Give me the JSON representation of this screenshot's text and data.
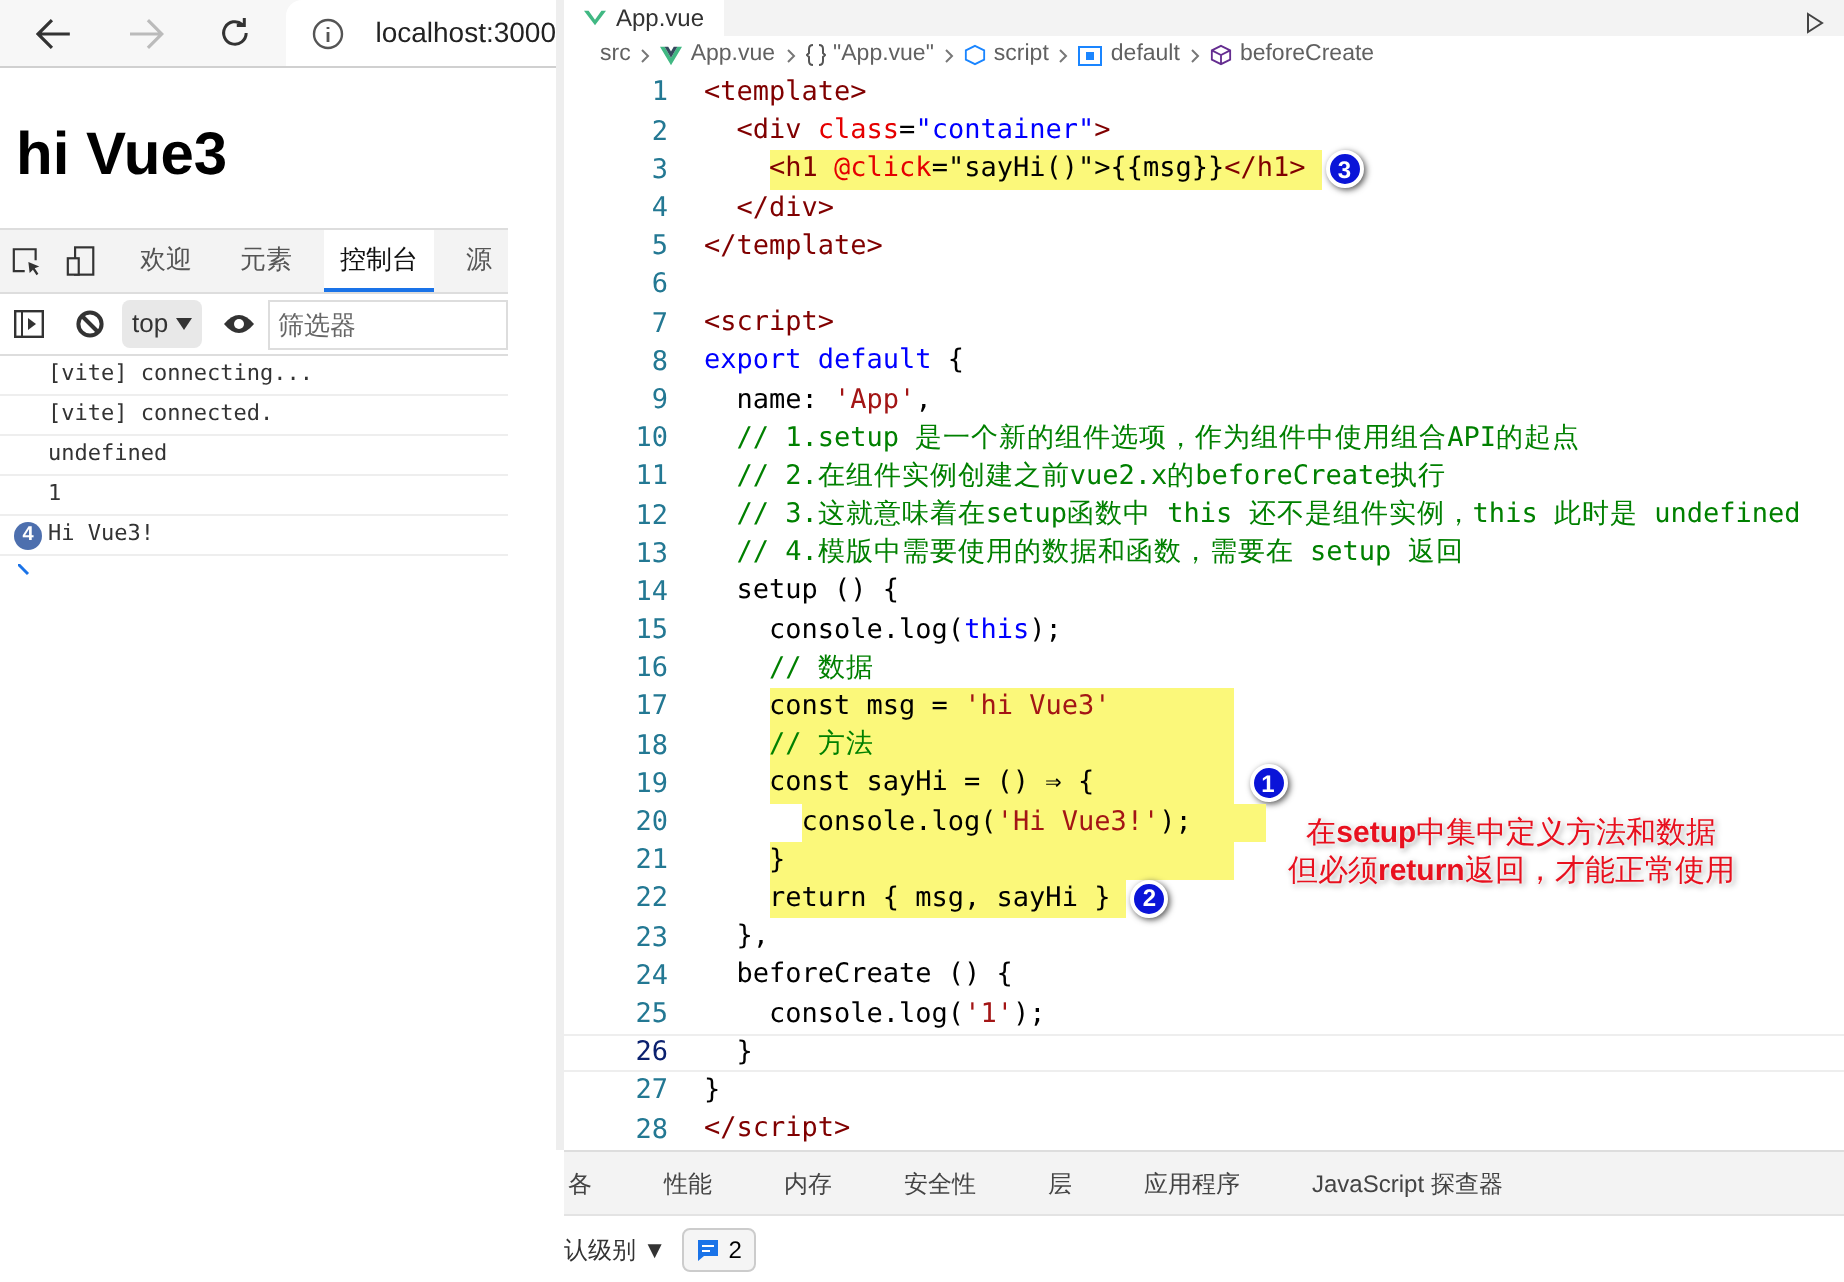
{
  "browser": {
    "url": "localhost:3000",
    "heading": "hi Vue3"
  },
  "devtools": {
    "tabs": [
      {
        "label": "欢迎",
        "selected": false
      },
      {
        "label": "元素",
        "selected": false
      },
      {
        "label": "控制台",
        "selected": true
      },
      {
        "label": "源",
        "selected": false
      }
    ],
    "context": "top",
    "filter_placeholder": "筛选器",
    "messages": [
      {
        "text": "[vite] connecting..."
      },
      {
        "text": "[vite] connected."
      },
      {
        "text": "undefined"
      },
      {
        "text": "1"
      },
      {
        "text": "Hi Vue3!",
        "count": "4"
      }
    ]
  },
  "editor": {
    "tab": "App.vue",
    "breadcrumbs": [
      {
        "kind": "folder",
        "text": "src"
      },
      {
        "kind": "vue",
        "text": "App.vue"
      },
      {
        "kind": "braces",
        "text": "\"App.vue\""
      },
      {
        "kind": "module",
        "text": "script"
      },
      {
        "kind": "variable",
        "text": "default"
      },
      {
        "kind": "method",
        "text": "beforeCreate"
      }
    ],
    "lines": [
      {
        "number": "1",
        "highlighted": false,
        "tokens": [
          {
            "kind": "tag",
            "text": "<template>"
          }
        ]
      },
      {
        "number": "2",
        "highlighted": false,
        "tokens": [
          {
            "kind": "tag",
            "text": "  <div "
          },
          {
            "kind": "attr",
            "text": "class"
          },
          {
            "kind": "plain",
            "text": "="
          },
          {
            "kind": "string",
            "text": "\"container\""
          },
          {
            "kind": "tag",
            "text": ">"
          }
        ]
      },
      {
        "number": "3",
        "highlighted": true,
        "callout": "3",
        "tokens": [
          {
            "kind": "tag",
            "text": "    <h1 "
          },
          {
            "kind": "attr",
            "text": "@click"
          },
          {
            "kind": "plain",
            "text": "=\"sayHi()\">{{msg}}"
          },
          {
            "kind": "tag",
            "text": "</h1>"
          }
        ]
      },
      {
        "number": "4",
        "highlighted": false,
        "tokens": [
          {
            "kind": "tag",
            "text": "  </div>"
          }
        ]
      },
      {
        "number": "5",
        "highlighted": false,
        "tokens": [
          {
            "kind": "tag",
            "text": "</template>"
          }
        ]
      },
      {
        "number": "6"
      },
      {
        "number": "7",
        "highlighted": false,
        "tokens": [
          {
            "kind": "tag",
            "text": "<script>"
          }
        ]
      },
      {
        "number": "8",
        "highlighted": false,
        "tokens": [
          {
            "kind": "keyword",
            "text": "export default"
          },
          {
            "kind": "plain",
            "text": " {"
          }
        ]
      },
      {
        "number": "9",
        "highlighted": false,
        "tokens": [
          {
            "kind": "plain",
            "text": "  name: "
          },
          {
            "kind": "literal",
            "text": "'App'"
          },
          {
            "kind": "plain",
            "text": ","
          }
        ]
      },
      {
        "number": "10",
        "highlighted": false,
        "tokens": [
          {
            "kind": "comment",
            "text": "  // 1.setup 是一个新的组件选项，作为组件中使用组合API的起点"
          }
        ]
      },
      {
        "number": "11",
        "highlighted": false,
        "tokens": [
          {
            "kind": "comment",
            "text": "  // 2.在组件实例创建之前vue2.x的beforeCreate执行"
          }
        ]
      },
      {
        "number": "12",
        "highlighted": false,
        "tokens": [
          {
            "kind": "comment",
            "text": "  // 3.这就意味着在setup函数中 this 还不是组件实例，this 此时是 undefined"
          }
        ]
      },
      {
        "number": "13",
        "highlighted": false,
        "tokens": [
          {
            "kind": "comment",
            "text": "  // 4.模版中需要使用的数据和函数，需要在 setup 返回"
          }
        ]
      },
      {
        "number": "14",
        "highlighted": false,
        "tokens": [
          {
            "kind": "plain",
            "text": "  setup () {"
          }
        ]
      },
      {
        "number": "15",
        "highlighted": false,
        "tokens": [
          {
            "kind": "plain",
            "text": "    console.log("
          },
          {
            "kind": "keyword",
            "text": "this"
          },
          {
            "kind": "plain",
            "text": ");"
          }
        ]
      },
      {
        "number": "16",
        "highlighted": false,
        "tokens": [
          {
            "kind": "comment",
            "text": "    // 数据"
          }
        ]
      },
      {
        "number": "17",
        "highlighted": true,
        "tokens": [
          {
            "kind": "plain",
            "text": "    const msg = "
          },
          {
            "kind": "literal",
            "text": "'hi Vue3'"
          }
        ]
      },
      {
        "number": "18",
        "highlighted": true,
        "tokens": [
          {
            "kind": "comment",
            "text": "    // 方法"
          }
        ]
      },
      {
        "number": "19",
        "highlighted": true,
        "callout": "1",
        "tokens": [
          {
            "kind": "plain",
            "text": "    const sayHi = () ⇒ {"
          }
        ]
      },
      {
        "number": "20",
        "highlighted": true,
        "tokens": [
          {
            "kind": "plain",
            "text": "      console.log("
          },
          {
            "kind": "literal",
            "text": "'Hi Vue3!'"
          },
          {
            "kind": "plain",
            "text": ");"
          }
        ]
      },
      {
        "number": "21",
        "highlighted": true,
        "tokens": [
          {
            "kind": "plain",
            "text": "    }"
          }
        ]
      },
      {
        "number": "22",
        "highlighted": true,
        "callout": "2",
        "tokens": [
          {
            "kind": "plain",
            "text": "    return { msg, sayHi }"
          }
        ]
      },
      {
        "number": "23",
        "highlighted": false,
        "tokens": [
          {
            "kind": "plain",
            "text": "  },"
          }
        ]
      },
      {
        "number": "24",
        "highlighted": false,
        "tokens": [
          {
            "kind": "plain",
            "text": "  beforeCreate () {"
          }
        ]
      },
      {
        "number": "25",
        "highlighted": false,
        "tokens": [
          {
            "kind": "plain",
            "text": "    console.log("
          },
          {
            "kind": "literal",
            "text": "'1'"
          },
          {
            "kind": "plain",
            "text": ");"
          }
        ]
      },
      {
        "number": "26",
        "highlighted": false,
        "tokens": [
          {
            "kind": "plain",
            "text": "  }"
          }
        ]
      },
      {
        "number": "27",
        "highlighted": false,
        "tokens": [
          {
            "kind": "plain",
            "text": "}"
          }
        ]
      },
      {
        "number": "28",
        "highlighted": false,
        "tokens": [
          {
            "kind": "tag",
            "text": "</script>"
          }
        ]
      }
    ],
    "note": [
      "在**setup**中集中定义方法和数据",
      "但必须**return**返回，才能正常使用"
    ]
  },
  "bottom_panel": {
    "tabs": [
      "各",
      "性能",
      "内存",
      "安全性",
      "层",
      "应用程序",
      "JavaScript 探查器"
    ],
    "level_filter": "认级别 ▼",
    "issues_count": "2"
  }
}
